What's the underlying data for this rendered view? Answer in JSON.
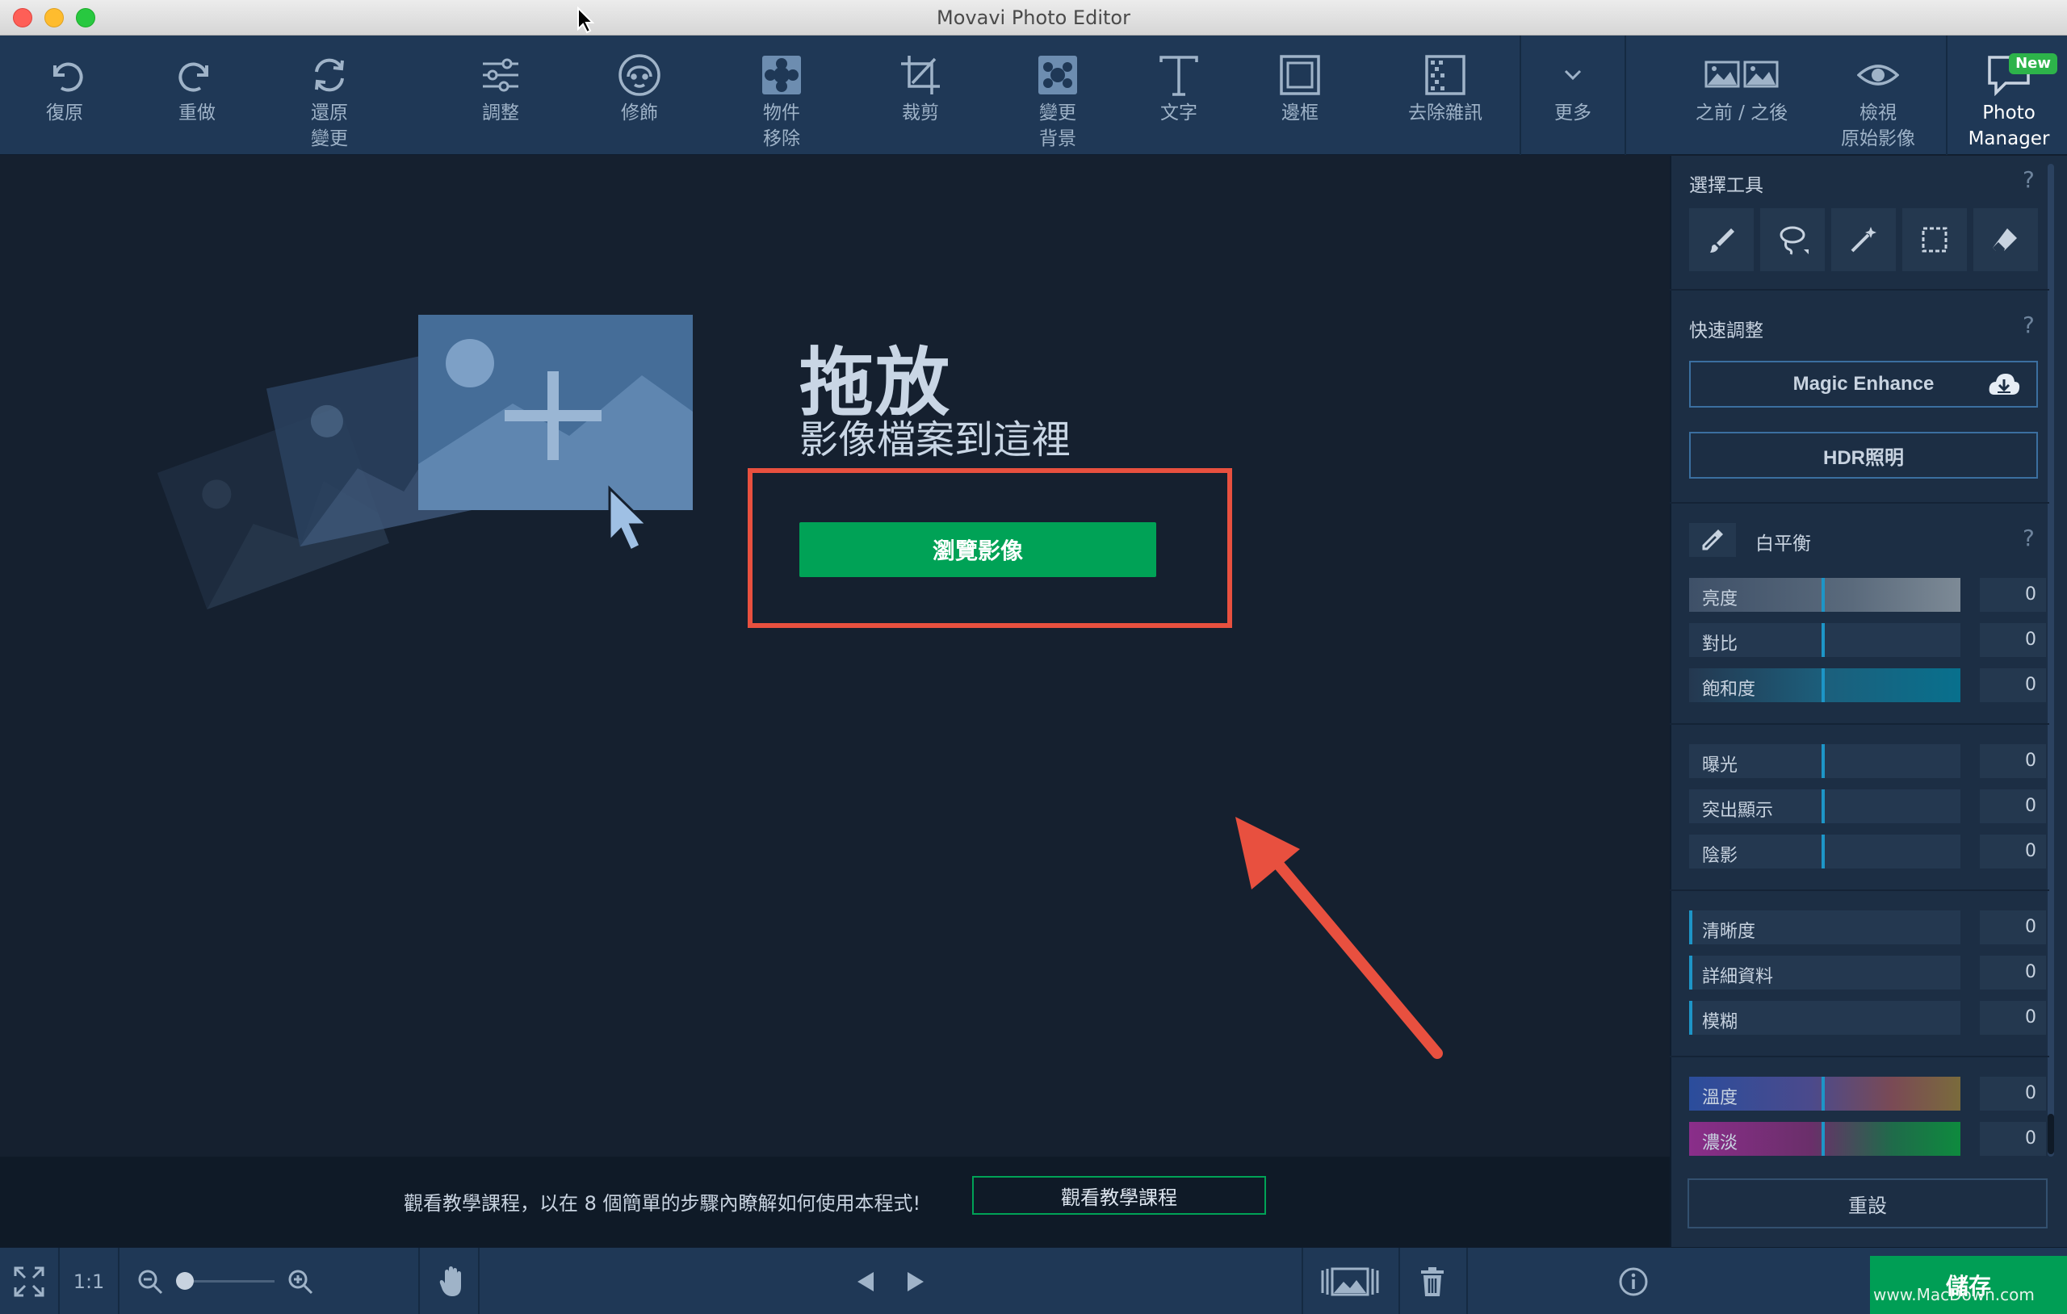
{
  "window": {
    "title": "Movavi Photo Editor"
  },
  "toolbar": {
    "undo": "復原",
    "redo": "重做",
    "revert": "還原\n變更",
    "adjust": "調整",
    "retouch": "修飾",
    "object_removal": "物件\n移除",
    "crop": "裁剪",
    "change_background": "變更\n背景",
    "text": "文字",
    "frame": "邊框",
    "denoise": "去除雜訊",
    "more": "更多",
    "before_after": "之前 / 之後",
    "view_original": "檢視\n原始影像",
    "photo_manager": "Photo\nManager",
    "new_badge": "New"
  },
  "canvas": {
    "drop_title": "拖放",
    "drop_subtitle": "影像檔案到這裡",
    "browse_button": "瀏覽影像"
  },
  "tutorial": {
    "text": "觀看教學課程，以在 8 個簡單的步驟內瞭解如何使用本程式!",
    "button": "觀看教學課程"
  },
  "bottombar": {
    "zoom_1to1": "1:1",
    "save_button": "儲存",
    "watermark": "www.MacDown.com"
  },
  "panel": {
    "selection_tools_title": "選擇工具",
    "quick_adjust_title": "快速調整",
    "magic_enhance": "Magic Enhance",
    "hdr_lighting": "HDR照明",
    "white_balance_title": "白平衡",
    "help_mark": "?",
    "sliders": {
      "brightness": {
        "label": "亮度",
        "value": "0"
      },
      "contrast": {
        "label": "對比",
        "value": "0"
      },
      "saturation": {
        "label": "飽和度",
        "value": "0"
      },
      "exposure": {
        "label": "曝光",
        "value": "0"
      },
      "highlights": {
        "label": "突出顯示",
        "value": "0"
      },
      "shadows": {
        "label": "陰影",
        "value": "0"
      },
      "clarity": {
        "label": "清晰度",
        "value": "0"
      },
      "detail": {
        "label": "詳細資料",
        "value": "0"
      },
      "blur": {
        "label": "模糊",
        "value": "0"
      },
      "temperature": {
        "label": "溫度",
        "value": "0"
      },
      "tint": {
        "label": "濃淡",
        "value": "0"
      }
    },
    "reset_button": "重設"
  },
  "colors": {
    "toolbar_bg": "#1f3856",
    "canvas_bg": "#15202f",
    "accent_green": "#00a256",
    "highlight_red": "#e8503f",
    "slider_marker": "#1d95c7"
  }
}
